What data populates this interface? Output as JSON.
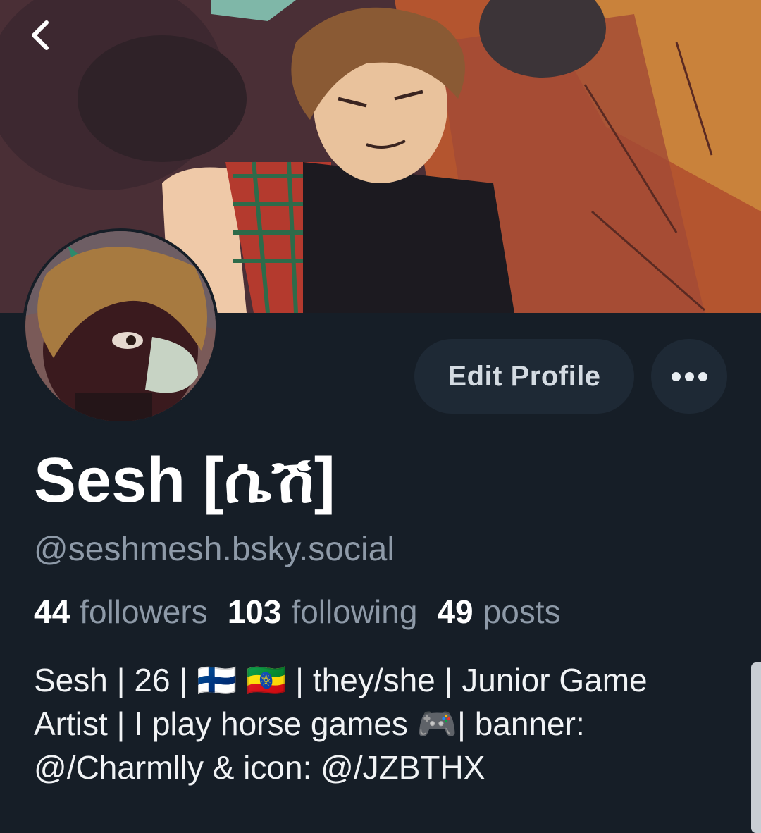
{
  "header": {
    "back_icon": "chevron-left-icon"
  },
  "profile": {
    "display_name": "Sesh [ሴሽ]",
    "handle": "@seshmesh.bsky.social",
    "edit_label": "Edit Profile",
    "more_icon": "ellipsis-icon"
  },
  "stats": {
    "followers_count": "44",
    "followers_label": "followers",
    "following_count": "103",
    "following_label": "following",
    "posts_count": "49",
    "posts_label": "posts"
  },
  "bio": {
    "line1": "Sesh | 26 | 🇫🇮 🇪🇹 | they/she | Junior Game",
    "line2": "Artist | I play horse games 🎮| banner:",
    "line3": "@/Charmlly & icon: @/JZBTHX"
  },
  "colors": {
    "background": "#161e27",
    "button_bg": "#1e2935",
    "muted_text": "#8e9aa8"
  }
}
